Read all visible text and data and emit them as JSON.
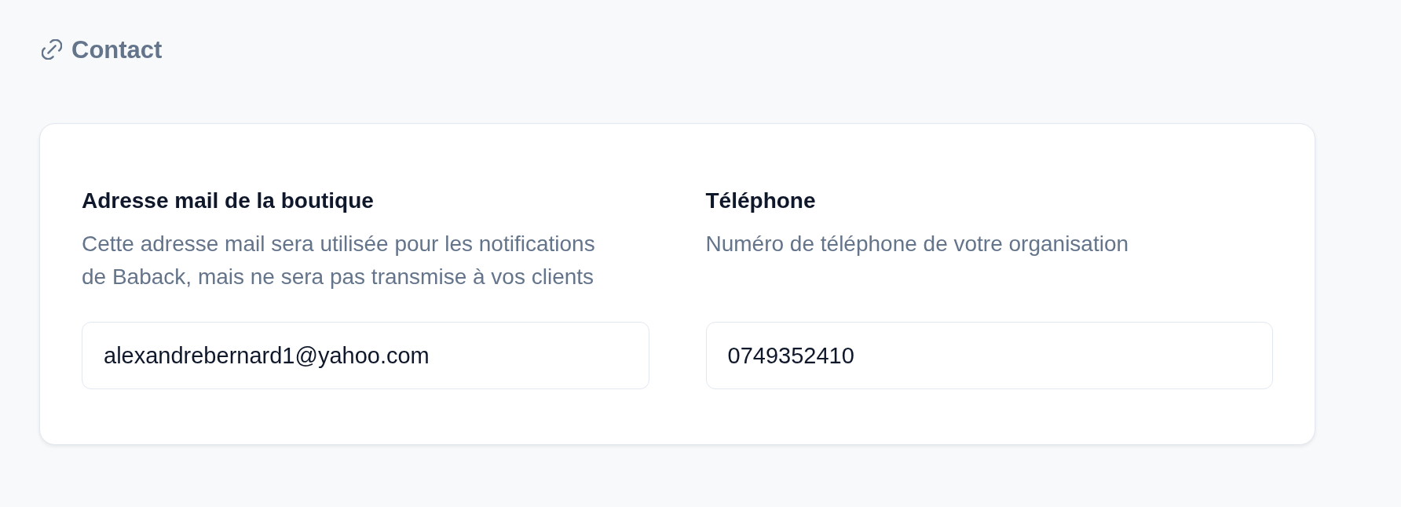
{
  "header": {
    "title": "Contact"
  },
  "fields": [
    {
      "label": "Adresse mail de la boutique",
      "description": "Cette adresse mail sera utilisée pour les notifications de Baback, mais ne sera pas transmise à vos clients",
      "value": "alexandrebernard1@yahoo.com"
    },
    {
      "label": "Téléphone",
      "description": "Numéro de téléphone de votre organisation",
      "value": "0749352410"
    }
  ]
}
